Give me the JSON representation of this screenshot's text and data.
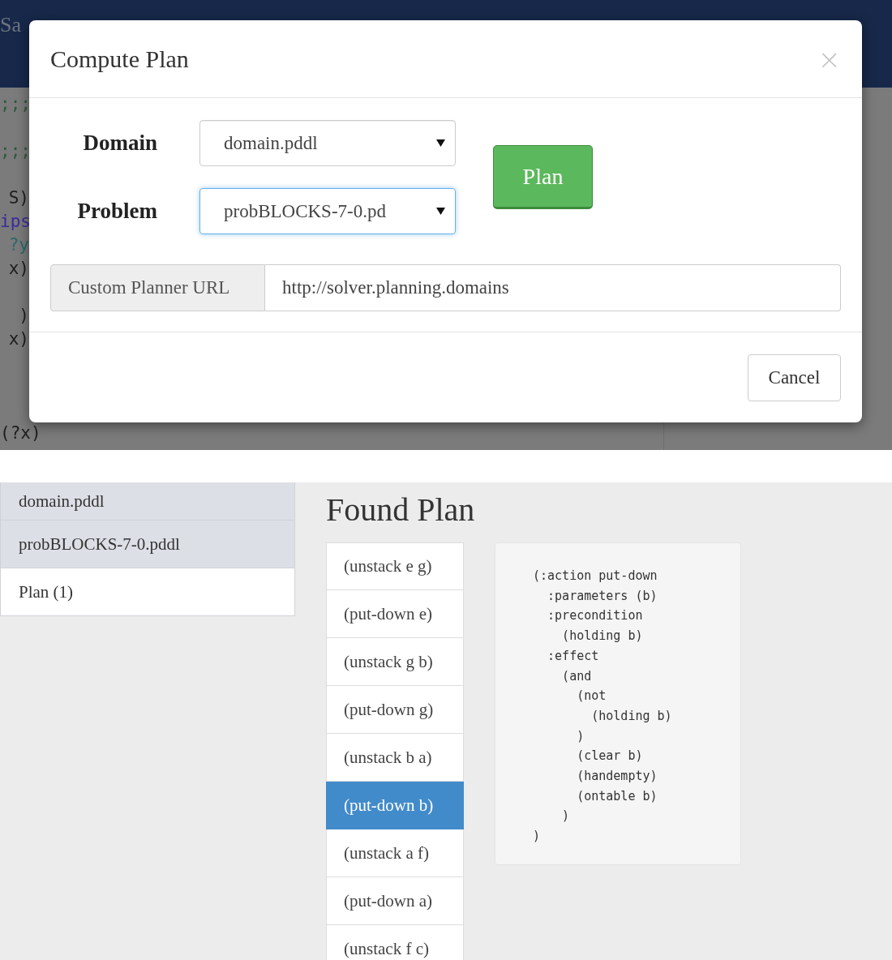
{
  "navbar": {
    "items": [
      {
        "label": "Sa"
      }
    ]
  },
  "editor": {
    "lines": [
      {
        "kind": "comment",
        "text": ";;;"
      },
      {
        "kind": "blank"
      },
      {
        "kind": "comment",
        "text": ";;;"
      },
      {
        "kind": "blank"
      },
      {
        "kind": "code",
        "text": "S)"
      },
      {
        "kind": "keyword",
        "text": "ips"
      },
      {
        "kind": "var",
        "text": "?y"
      },
      {
        "kind": "code",
        "text": "x)"
      },
      {
        "kind": "blank"
      },
      {
        "kind": "code",
        "text": ")"
      },
      {
        "kind": "code",
        "text": "x)"
      },
      {
        "kind": "blank"
      },
      {
        "kind": "blank"
      },
      {
        "kind": "blank"
      },
      {
        "kind": "code",
        "text": "(?x)"
      }
    ]
  },
  "modal": {
    "title": "Compute Plan",
    "close": "×",
    "fields": [
      {
        "label": "Domain",
        "value": "domain.pddl",
        "focused": false
      },
      {
        "label": "Problem",
        "value": "probBLOCKS-7-0.pd",
        "focused": true
      }
    ],
    "plan_button": "Plan",
    "planner_url": {
      "label": "Custom Planner URL",
      "value": "http://solver.planning.domains"
    },
    "cancel_button": "Cancel"
  },
  "sidebar": {
    "items": [
      {
        "label": "domain.pddl",
        "kind": "file"
      },
      {
        "label": "probBLOCKS-7-0.pddl",
        "kind": "file"
      },
      {
        "label": "Plan (1)",
        "kind": "plan"
      }
    ]
  },
  "found_plan": {
    "title": "Found Plan",
    "steps": [
      {
        "label": "(unstack e g)",
        "selected": false
      },
      {
        "label": "(put-down e)",
        "selected": false
      },
      {
        "label": "(unstack g b)",
        "selected": false
      },
      {
        "label": "(put-down g)",
        "selected": false
      },
      {
        "label": "(unstack b a)",
        "selected": false
      },
      {
        "label": "(put-down b)",
        "selected": true
      },
      {
        "label": "(unstack a f)",
        "selected": false
      },
      {
        "label": "(put-down a)",
        "selected": false
      },
      {
        "label": "(unstack f c)",
        "selected": false
      }
    ],
    "code": [
      "(:action put-down",
      "  :parameters (b)",
      "  :precondition",
      "    (holding b)",
      "  :effect",
      "    (and",
      "      (not",
      "        (holding b)",
      "      )",
      "      (clear b)",
      "      (handempty)",
      "      (ontable b)",
      "    )",
      ")"
    ]
  }
}
